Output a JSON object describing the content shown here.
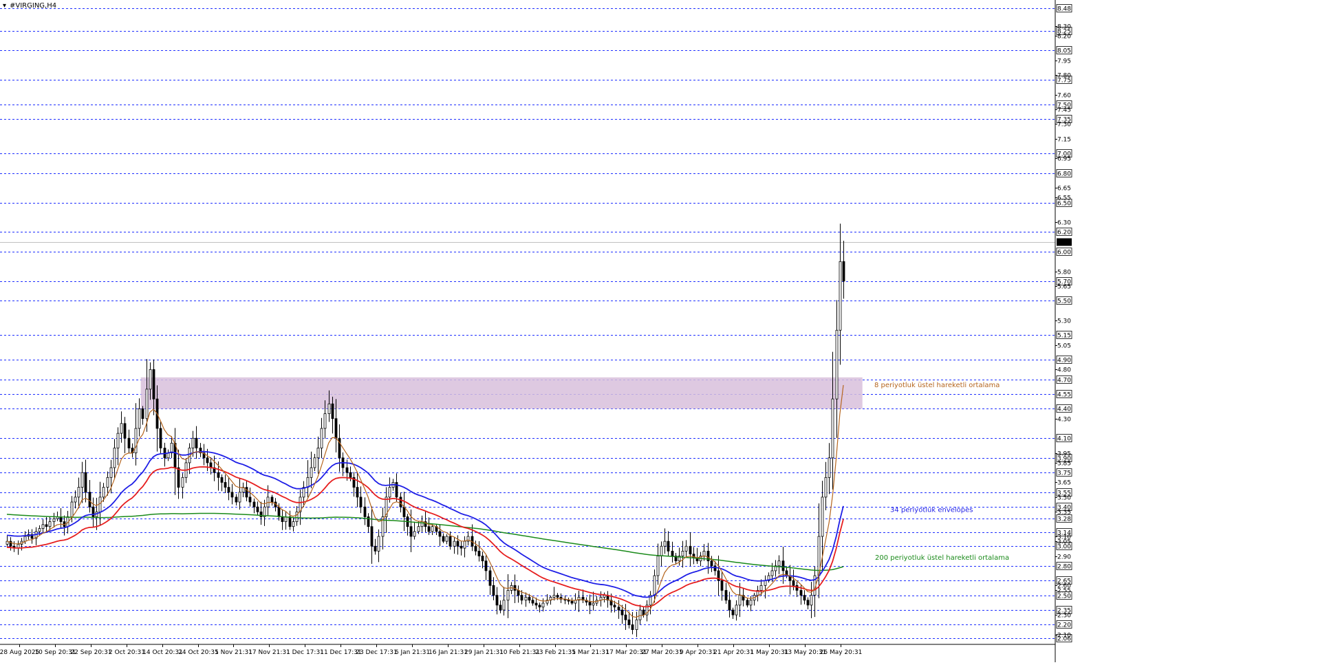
{
  "window": {
    "title": "#VIRGING,H4"
  },
  "colors": {
    "background": "#ffffff",
    "candle": "#000000",
    "ema8": "#b5651d",
    "ema34_upper": "#1e1ee6",
    "ema34_lower": "#e61e1e",
    "ema200": "#1a8a1a",
    "zone": "#d8bfdc",
    "grid": "#1c2dff",
    "current_price_bg": "#000000"
  },
  "annotations": {
    "ema8": "8 periyotluk üstel hareketli ortalama",
    "envelopes": "34 periyotluk envelopes",
    "ema200": "200 periyotluk üstel hareketli ortalama"
  },
  "chart_data": {
    "type": "candlestick",
    "symbol": "#VIRGING",
    "timeframe": "H4",
    "current_price": 6.1,
    "ylim": [
      2.0,
      8.55
    ],
    "x_tick_labels": [
      "28 Aug 2025",
      "10 Sep 20:31",
      "22 Sep 20:31",
      "2 Oct 20:31",
      "14 Oct 20:31",
      "24 Oct 20:31",
      "5 Nov 21:31",
      "17 Nov 21:31",
      "1 Dec 17:31",
      "11 Dec 17:31",
      "23 Dec 17:31",
      "6 Jan 21:31",
      "16 Jan 21:31",
      "29 Jan 21:31",
      "10 Feb 21:31",
      "23 Feb 21:31",
      "5 Mar 21:31",
      "17 Mar 20:31",
      "27 Mar 20:31",
      "9 Apr 20:31",
      "21 Apr 20:31",
      "1 May 20:31",
      "13 May 20:31",
      "26 May 20:31"
    ],
    "dashed_levels": [
      8.48,
      8.25,
      8.05,
      7.75,
      7.5,
      7.35,
      7.0,
      6.8,
      6.5,
      6.2,
      6.0,
      5.7,
      5.5,
      5.15,
      4.9,
      4.7,
      4.55,
      4.4,
      4.1,
      3.9,
      3.75,
      3.55,
      3.4,
      3.28,
      3.14,
      3.0,
      2.8,
      2.65,
      2.5,
      2.35,
      2.2,
      2.06
    ],
    "minor_ticks": [
      8.3,
      8.2,
      7.95,
      7.8,
      7.6,
      7.45,
      7.3,
      7.15,
      6.95,
      6.65,
      6.55,
      6.3,
      5.8,
      5.65,
      5.3,
      5.05,
      4.8,
      4.3,
      3.95,
      3.85,
      3.65,
      3.5,
      3.35,
      3.1,
      3.05,
      2.9,
      2.6,
      2.55,
      2.3,
      2.1
    ],
    "zone": {
      "from": 4.4,
      "to": 4.72,
      "x_start": "14 Oct 20:31",
      "x_end": "26 May 20:31"
    },
    "series": [
      {
        "name": "price",
        "close": [
          3.05,
          3.0,
          2.98,
          3.02,
          3.05,
          3.1,
          3.12,
          3.08,
          3.15,
          3.18,
          3.22,
          3.2,
          3.25,
          3.28,
          3.3,
          3.25,
          3.2,
          3.3,
          3.45,
          3.5,
          3.6,
          3.75,
          3.55,
          3.4,
          3.3,
          3.35,
          3.5,
          3.6,
          3.7,
          3.8,
          4.0,
          4.15,
          4.25,
          4.1,
          4.0,
          3.95,
          4.2,
          4.4,
          4.3,
          4.6,
          4.8,
          4.5,
          4.2,
          4.0,
          3.9,
          3.95,
          4.05,
          3.8,
          3.6,
          3.7,
          3.85,
          4.0,
          4.1,
          4.0,
          3.95,
          3.9,
          3.85,
          3.8,
          3.75,
          3.7,
          3.65,
          3.6,
          3.55,
          3.5,
          3.45,
          3.55,
          3.6,
          3.5,
          3.45,
          3.4,
          3.35,
          3.3,
          3.4,
          3.5,
          3.45,
          3.4,
          3.3,
          3.25,
          3.3,
          3.2,
          3.25,
          3.35,
          3.5,
          3.6,
          3.7,
          3.8,
          3.9,
          4.0,
          4.2,
          4.35,
          4.45,
          4.3,
          4.1,
          3.9,
          3.8,
          3.75,
          3.7,
          3.6,
          3.5,
          3.4,
          3.3,
          3.2,
          3.0,
          2.95,
          3.1,
          3.3,
          3.5,
          3.6,
          3.65,
          3.5,
          3.4,
          3.3,
          3.2,
          3.1,
          3.15,
          3.2,
          3.25,
          3.2,
          3.15,
          3.2,
          3.15,
          3.1,
          3.05,
          3.1,
          3.0,
          3.05,
          3.0,
          2.98,
          3.05,
          3.1,
          3.0,
          2.95,
          2.9,
          2.85,
          2.75,
          2.6,
          2.5,
          2.4,
          2.35,
          2.45,
          2.55,
          2.6,
          2.55,
          2.5,
          2.45,
          2.48,
          2.45,
          2.42,
          2.4,
          2.38,
          2.42,
          2.45,
          2.48,
          2.5,
          2.48,
          2.46,
          2.45,
          2.44,
          2.42,
          2.45,
          2.48,
          2.45,
          2.43,
          2.4,
          2.42,
          2.45,
          2.48,
          2.5,
          2.45,
          2.4,
          2.38,
          2.35,
          2.3,
          2.25,
          2.2,
          2.15,
          2.25,
          2.35,
          2.3,
          2.4,
          2.5,
          2.7,
          2.9,
          3.0,
          3.05,
          2.95,
          2.9,
          2.85,
          2.9,
          2.95,
          3.0,
          2.92,
          2.88,
          2.85,
          2.9,
          2.95,
          2.85,
          2.8,
          2.75,
          2.65,
          2.55,
          2.45,
          2.35,
          2.3,
          2.4,
          2.5,
          2.45,
          2.4,
          2.45,
          2.5,
          2.55,
          2.6,
          2.65,
          2.7,
          2.75,
          2.8,
          2.85,
          2.75,
          2.7,
          2.65,
          2.6,
          2.55,
          2.5,
          2.45,
          2.4,
          2.5,
          2.7,
          3.1,
          3.5,
          3.7,
          3.9,
          4.5,
          5.2,
          5.9,
          5.7
        ]
      },
      {
        "name": "EMA 8"
      },
      {
        "name": "Envelopes 34 upper"
      },
      {
        "name": "Envelopes 34 lower"
      },
      {
        "name": "EMA 200"
      }
    ]
  }
}
